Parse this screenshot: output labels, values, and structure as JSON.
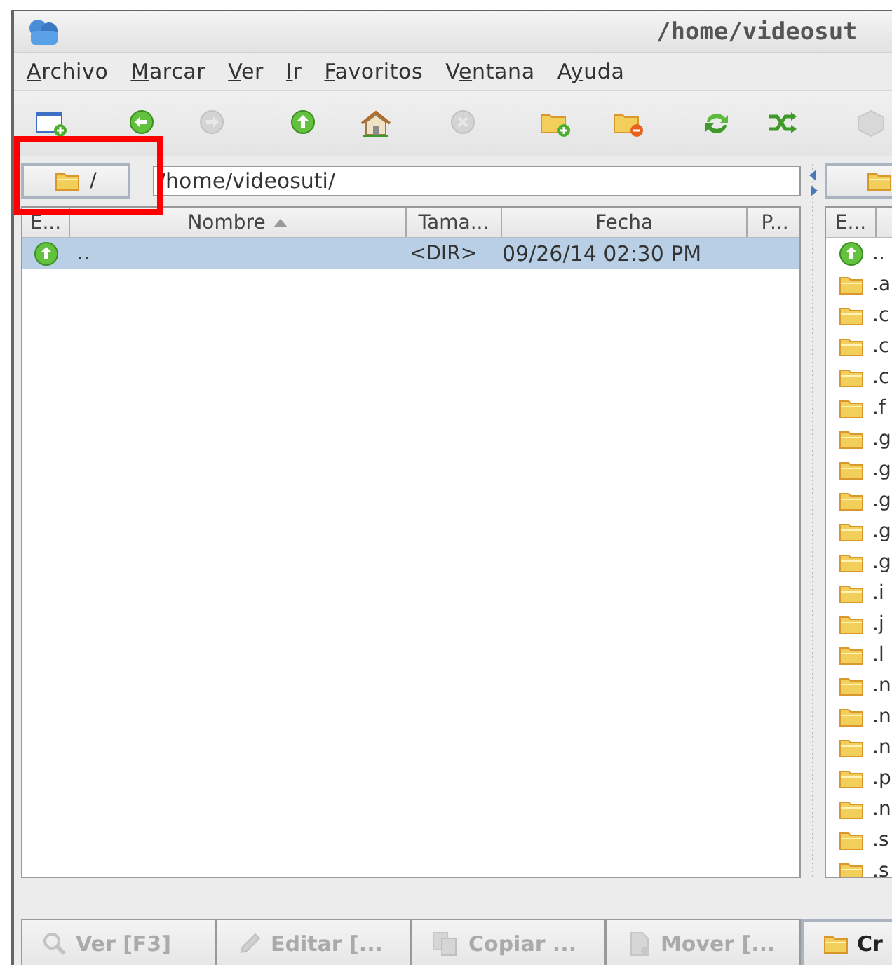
{
  "window": {
    "title": "/home/videosut"
  },
  "menu": [
    {
      "label": "Archivo"
    },
    {
      "label": "Marcar"
    },
    {
      "label": "Ver"
    },
    {
      "label": "Ir"
    },
    {
      "label": "Favoritos"
    },
    {
      "label": "Ventana"
    },
    {
      "label": "Ayuda"
    }
  ],
  "toolbar": [
    {
      "kind": "new-window",
      "disabled": false
    },
    {
      "kind": "back",
      "disabled": false
    },
    {
      "kind": "forward",
      "disabled": true
    },
    {
      "kind": "up",
      "disabled": false
    },
    {
      "kind": "home",
      "disabled": false
    },
    {
      "kind": "stop",
      "disabled": true
    },
    {
      "kind": "new-folder",
      "disabled": false
    },
    {
      "kind": "delete-folder",
      "disabled": false
    },
    {
      "kind": "refresh",
      "disabled": false
    },
    {
      "kind": "sync",
      "disabled": false
    },
    {
      "kind": "cube",
      "disabled": true
    }
  ],
  "left_panel": {
    "root_button": "/",
    "path": "/home/videosuti/",
    "columns": [
      {
        "label": "E..."
      },
      {
        "label": "Nombre",
        "sorted": true
      },
      {
        "label": "Tama..."
      },
      {
        "label": "Fecha"
      },
      {
        "label": "P..."
      }
    ],
    "rows": [
      {
        "kind": "up",
        "name": "..",
        "size": "<DIR>",
        "date": "09/26/14 02:30 PM",
        "selected": true
      }
    ]
  },
  "right_panel": {
    "columns": [
      {
        "label": "E..."
      }
    ],
    "rows": [
      {
        "kind": "up",
        "name": "..",
        "selected": false
      },
      {
        "kind": "folder",
        "name": ".a",
        "selected": false
      },
      {
        "kind": "folder",
        "name": ".c",
        "selected": false
      },
      {
        "kind": "folder",
        "name": ".c",
        "selected": false
      },
      {
        "kind": "folder",
        "name": ".c",
        "selected": false
      },
      {
        "kind": "folder",
        "name": ".f",
        "selected": false
      },
      {
        "kind": "folder",
        "name": ".g",
        "selected": false
      },
      {
        "kind": "folder",
        "name": ".g",
        "selected": false
      },
      {
        "kind": "folder",
        "name": ".g",
        "selected": false
      },
      {
        "kind": "folder",
        "name": ".g",
        "selected": false
      },
      {
        "kind": "folder",
        "name": ".g",
        "selected": false
      },
      {
        "kind": "folder",
        "name": ".i",
        "selected": false
      },
      {
        "kind": "folder",
        "name": ".j",
        "selected": false
      },
      {
        "kind": "folder",
        "name": ".l",
        "selected": false
      },
      {
        "kind": "folder",
        "name": ".n",
        "selected": false
      },
      {
        "kind": "folder",
        "name": ".n",
        "selected": false
      },
      {
        "kind": "folder",
        "name": ".n",
        "selected": false
      },
      {
        "kind": "folder",
        "name": ".p",
        "selected": false
      },
      {
        "kind": "folder",
        "name": ".n",
        "selected": false
      },
      {
        "kind": "folder",
        "name": ".s",
        "selected": false
      },
      {
        "kind": "folder",
        "name": ".s",
        "selected": false
      }
    ]
  },
  "commands": [
    {
      "kind": "view",
      "label": "Ver [F3]",
      "disabled": true
    },
    {
      "kind": "edit",
      "label": "Editar [...",
      "disabled": true
    },
    {
      "kind": "copy",
      "label": "Copiar ...",
      "disabled": true
    },
    {
      "kind": "move",
      "label": "Mover [...",
      "disabled": true
    },
    {
      "kind": "folder",
      "label": "Cr",
      "disabled": false
    }
  ]
}
